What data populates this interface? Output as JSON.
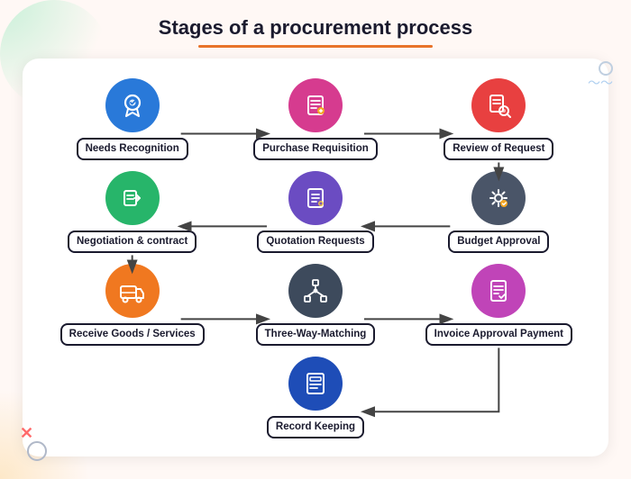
{
  "title": "Stages of a procurement process",
  "stages": [
    {
      "id": "needs-recognition",
      "label": "Needs Recognition",
      "color": "blue",
      "colorHex": "#2979d9",
      "icon": "award"
    },
    {
      "id": "purchase-requisition",
      "label": "Purchase Requisition",
      "color": "pink",
      "colorHex": "#d63b8f",
      "icon": "list"
    },
    {
      "id": "review-of-request",
      "label": "Review of Request",
      "color": "red",
      "colorHex": "#e84040",
      "icon": "search"
    },
    {
      "id": "negotiation-contract",
      "label": "Negotiation & contract",
      "color": "green",
      "colorHex": "#27b56a",
      "icon": "handshake"
    },
    {
      "id": "quotation-requests",
      "label": "Quotation Requests",
      "color": "purple",
      "colorHex": "#6b4cc2",
      "icon": "doc"
    },
    {
      "id": "budget-approval",
      "label": "Budget Approval",
      "color": "dark-gray",
      "colorHex": "#4a5568",
      "icon": "gear"
    },
    {
      "id": "receive-goods",
      "label": "Receive Goods / Services",
      "color": "orange",
      "colorHex": "#f07820",
      "icon": "truck"
    },
    {
      "id": "three-way-matching",
      "label": "Three-Way-Matching",
      "color": "dark2",
      "colorHex": "#3d4a5c",
      "icon": "network"
    },
    {
      "id": "invoice-approval",
      "label": "Invoice Approval Payment",
      "color": "magenta",
      "colorHex": "#c044b8",
      "icon": "invoice"
    },
    {
      "id": "record-keeping",
      "label": "Record Keeping",
      "color": "navy",
      "colorHex": "#1e4db7",
      "icon": "records"
    }
  ],
  "decorations": {
    "x_symbol": "✕",
    "wave_symbol": "〜〜"
  }
}
